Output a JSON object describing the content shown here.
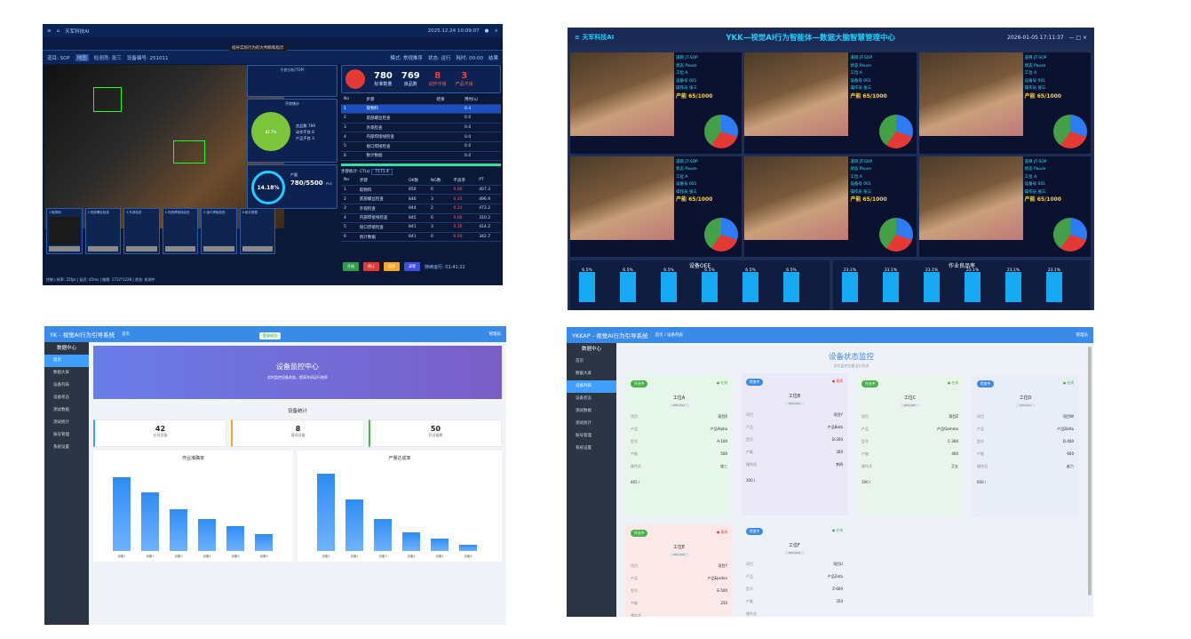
{
  "p1": {
    "title": "天军科技AI",
    "tb_info": "指导实际行为的大判断和指示",
    "datetime": "2025.12.24 10:09:07",
    "row2": [
      "道目: SOP",
      "地图",
      "检测员: 张三",
      "设备编号: 251011"
    ],
    "row2r": [
      "模式: 常规推序",
      "状态: 运行",
      "耗时: 00:00",
      "结果"
    ],
    "summary_title": "不良分析(TOP)",
    "mid_title": "不良统计",
    "ring_text": "82.7%",
    "kpis": [
      {
        "v": "780",
        "l": "标准数量"
      },
      {
        "v": "769",
        "l": "良品数"
      },
      {
        "v": "8",
        "l": "动作不良"
      },
      {
        "v": "3",
        "l": "产品不良"
      }
    ],
    "donut_lbls": [
      {
        "k": "良品数",
        "v": "769"
      },
      {
        "k": "动作不良",
        "v": "8"
      },
      {
        "k": "产品不良",
        "v": "3"
      }
    ],
    "pct": "14.18%",
    "prod_lbl": "产量",
    "prod": "780/5500",
    "prod_unit": "PCS",
    "top_headers": [
      "No",
      "步骤",
      "结果",
      "用时(s)"
    ],
    "steps": [
      [
        "1",
        "取物料",
        "",
        "0.4"
      ],
      [
        "2",
        "底部螺丝检查",
        "",
        "0.0"
      ],
      [
        "3",
        "外观检查",
        "",
        "0.0"
      ],
      [
        "4",
        "内部焊接线检查",
        "",
        "0.0"
      ],
      [
        "5",
        "接口焊接检查",
        "",
        "0.0"
      ],
      [
        "6",
        "数计数据",
        "",
        "0.0"
      ]
    ],
    "ct_label": "步骤统计: CT(s)",
    "ct_val": "7171.4",
    "bot_headers": [
      "No",
      "步骤",
      "OK数",
      "NG数",
      "不良率",
      "PT"
    ],
    "rows": [
      [
        "1",
        "取物料",
        "850",
        "0",
        "0.00",
        "407.3"
      ],
      [
        "2",
        "底部螺丝检查",
        "846",
        "3",
        "0.35",
        "496.9"
      ],
      [
        "3",
        "外观检查",
        "844",
        "2",
        "0.24",
        "473.2"
      ],
      [
        "4",
        "内部焊接线检查",
        "845",
        "0",
        "0.00",
        "310.2"
      ],
      [
        "5",
        "接口焊接检查",
        "841",
        "3",
        "0.36",
        "414.2"
      ],
      [
        "6",
        "统计数据",
        "841",
        "0",
        "0.00",
        "342.7"
      ]
    ],
    "thumbs": [
      "1.取物料",
      "2.底部螺丝检查",
      "3.外观检查",
      "4.内部焊接线检查",
      "5.接口焊接检查",
      "6.统计数据"
    ],
    "buttons": [
      "开始",
      "停止",
      "暂停",
      "清零"
    ],
    "run_time": "持续运行: 01:41:22",
    "status": "控制 | 帧率: 25fps | 延迟: 45ms | 推理: 1712*1228 | 状态: 检测中"
  },
  "p2": {
    "title": "YKK—视觉AI行为智能体—数据大脑智慧管理中心",
    "brand": "天军科技AI",
    "datetime": "2026-01-05 17:11:37",
    "info": [
      "道目 JT-SOP",
      "状态 Pause",
      "工位 A",
      "设备号 001",
      "操作员 张三"
    ],
    "yield": "产能 65/1000",
    "chart1": "设备OEE",
    "chart2": "作业良品率",
    "oee_vals": [
      "6.5%",
      "6.5%",
      "6.5%",
      "6.5%",
      "6.5%",
      "6.5%"
    ],
    "yr_vals": [
      "23.1%",
      "23.1%",
      "23.1%",
      "23.1%",
      "23.1%",
      "23.1%"
    ]
  },
  "p3": {
    "title": "YK - 视觉AI行为引导系统",
    "crumb": "首页",
    "toast": "登录成功",
    "user": "管理员",
    "sidebar": [
      "数据中心",
      "首页",
      "数据大屏",
      "设备列表",
      "设备状态",
      "测试数据",
      "测试统计",
      "账号管理",
      "系统设置"
    ],
    "banner_t": "设备监控中心",
    "banner_s": "实时监控设备状态，提高车间运行效率",
    "stats_t": "设备统计",
    "stats": [
      {
        "v": "42",
        "l": "在线设备"
      },
      {
        "v": "8",
        "l": "离线设备"
      },
      {
        "v": "50",
        "l": "总设备数"
      }
    ],
    "c1": "作业准确率",
    "c2": "产量达成率",
    "cats": [
      "设备1",
      "设备2",
      "设备3",
      "设备4",
      "设备5",
      "设备6"
    ],
    "c1_vals": [
      35,
      28,
      20,
      15,
      12,
      8
    ],
    "c2_vals": [
      11,
      7.3,
      4.5,
      2.7,
      1.8,
      0.9
    ]
  },
  "p4": {
    "title": "YKKAP - 视觉AI行为引导系统",
    "crumb": "首页 / 设备列表",
    "user": "管理员",
    "sidebar": [
      "数据中心",
      "首页",
      "数据大屏",
      "设备列表",
      "设备状态",
      "测试数据",
      "测试统计",
      "账号管理",
      "系统设置"
    ],
    "title_main": "设备状态监控",
    "sub": "实时监控设备运行状态",
    "labels": [
      "项目",
      "产品",
      "型号",
      "产能",
      "操作员"
    ],
    "cards": [
      {
        "tag": "作业中",
        "st": "在线",
        "name": "工位A",
        "dev": "DEV-001",
        "vals": [
          "项目X",
          "产品Alpha",
          "A-100",
          "500",
          "张三"
        ],
        "foot": "465 /",
        "bg": "#e6f6ea",
        "tagc": "#4caf50",
        "stc": "#4caf50"
      },
      {
        "tag": "检查中",
        "st": "离线",
        "name": "工位B",
        "dev": "DEV-002",
        "vals": [
          "项目Y",
          "产品Beta",
          "B-200",
          "300",
          "李四"
        ],
        "foot": "200 /",
        "bg": "#ebe8f8",
        "tagc": "#3a8ae8",
        "stc": "#e53935"
      },
      {
        "tag": "作业中",
        "st": "在线",
        "name": "工位C",
        "dev": "DEV-003",
        "vals": [
          "项目Z",
          "产品Gamma",
          "C-300",
          "400",
          "王五"
        ],
        "foot": "390 /",
        "bg": "#e9f5ec",
        "tagc": "#4caf50",
        "stc": "#4caf50"
      },
      {
        "tag": "检查中",
        "st": "在线",
        "name": "工位D",
        "dev": "DEV-004",
        "vals": [
          "项目W",
          "产品Delta",
          "D-400",
          "600",
          "赵六"
        ],
        "foot": "600 /",
        "bg": "#e8edf8",
        "tagc": "#3a8ae8",
        "stc": "#4caf50"
      },
      {
        "tag": "作业中",
        "st": "离线",
        "name": "工位E",
        "dev": "DEV-005",
        "vals": [
          "项目Y",
          "产品Epsilon",
          "E-500",
          "250",
          ""
        ],
        "foot": "",
        "bg": "#fbe9e9",
        "tagc": "#4caf50",
        "stc": "#e53935"
      },
      {
        "tag": "检查中",
        "st": "在线",
        "name": "工位F",
        "dev": "DEV-006",
        "vals": [
          "项目U",
          "产品Zeta",
          "Z-600",
          "350",
          ""
        ],
        "foot": "",
        "bg": "#eef2f8",
        "tagc": "#3a8ae8",
        "stc": "#4caf50"
      }
    ]
  }
}
